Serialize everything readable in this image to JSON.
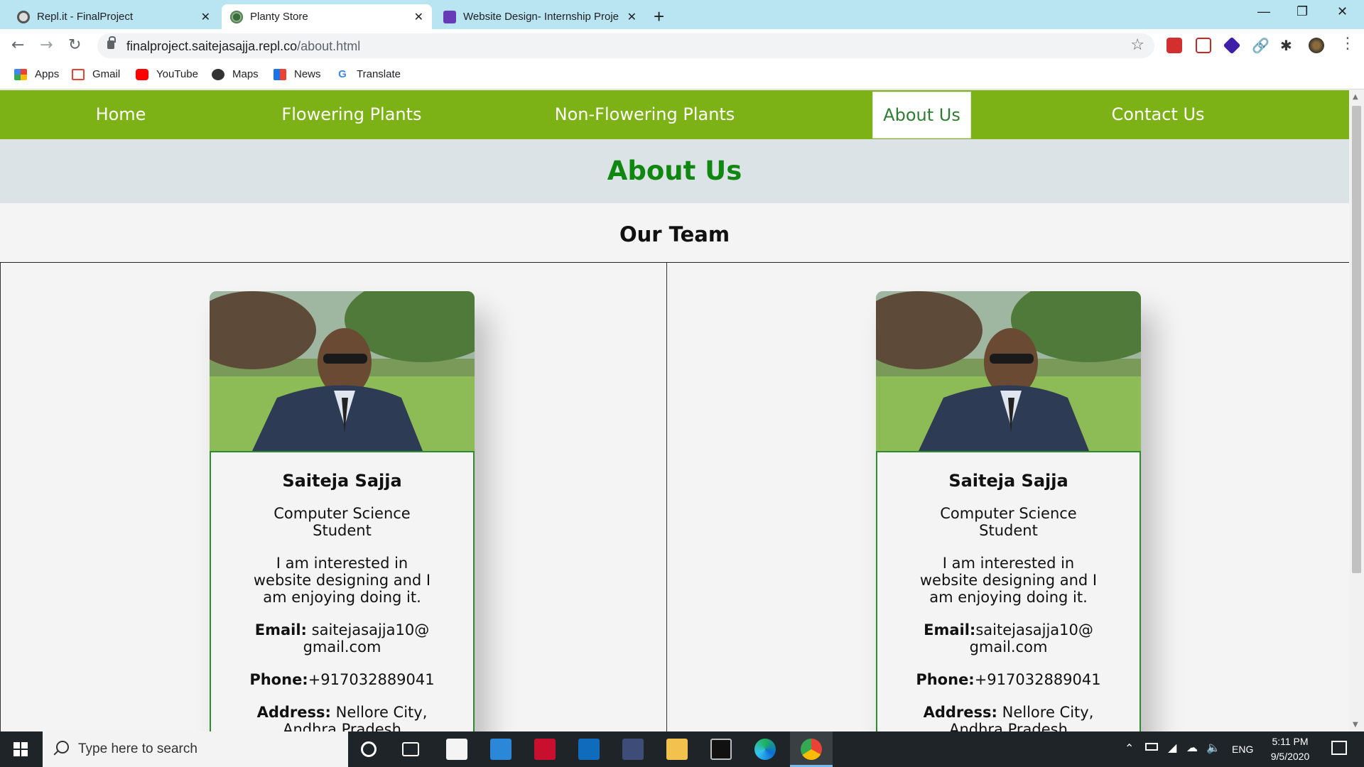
{
  "browser": {
    "tabs": [
      {
        "title": "Repl.it - FinalProject",
        "active": false
      },
      {
        "title": "Planty Store",
        "active": true
      },
      {
        "title": "Website Design- Internship Proje",
        "active": false
      }
    ],
    "url_host": "finalproject.saitejasajja.repl.co",
    "url_path": "/about.html",
    "bookmarks": [
      "Apps",
      "Gmail",
      "YouTube",
      "Maps",
      "News",
      "Translate"
    ]
  },
  "site": {
    "nav": [
      "Home",
      "Flowering Plants",
      "Non-Flowering Plants",
      "About Us",
      "Contact Us"
    ],
    "active_nav": "About Us",
    "page_title": "About Us",
    "section_title": "Our Team",
    "colors": {
      "nav_bg": "#7cb215",
      "title_green": "#108710",
      "banner_bg": "#dce3e6",
      "card_border": "#2e8b2e"
    },
    "members": [
      {
        "name": "Saiteja Sajja",
        "role": "Computer Science Student",
        "bio": "I am interested in website designing and I am enjoying doing it.",
        "email_label": "Email:",
        "email": "saitejasajja10@ gmail.com",
        "phone_label": "Phone:",
        "phone": "+917032889041",
        "address_label": "Address:",
        "address": "Nellore City, Andhra Pradesh"
      },
      {
        "name": "Saiteja Sajja",
        "role": "Computer Science Student",
        "bio": "I am interested in website designing and I am enjoying doing it.",
        "email_label": "Email:",
        "email": "saitejasajja10@ gmail.com",
        "phone_label": "Phone:",
        "phone": "+917032889041",
        "address_label": "Address:",
        "address": "Nellore City, Andhra Pradesh"
      }
    ]
  },
  "taskbar": {
    "search_placeholder": "Type here to search",
    "language": "ENG",
    "time": "5:11 PM",
    "date": "9/5/2020"
  }
}
